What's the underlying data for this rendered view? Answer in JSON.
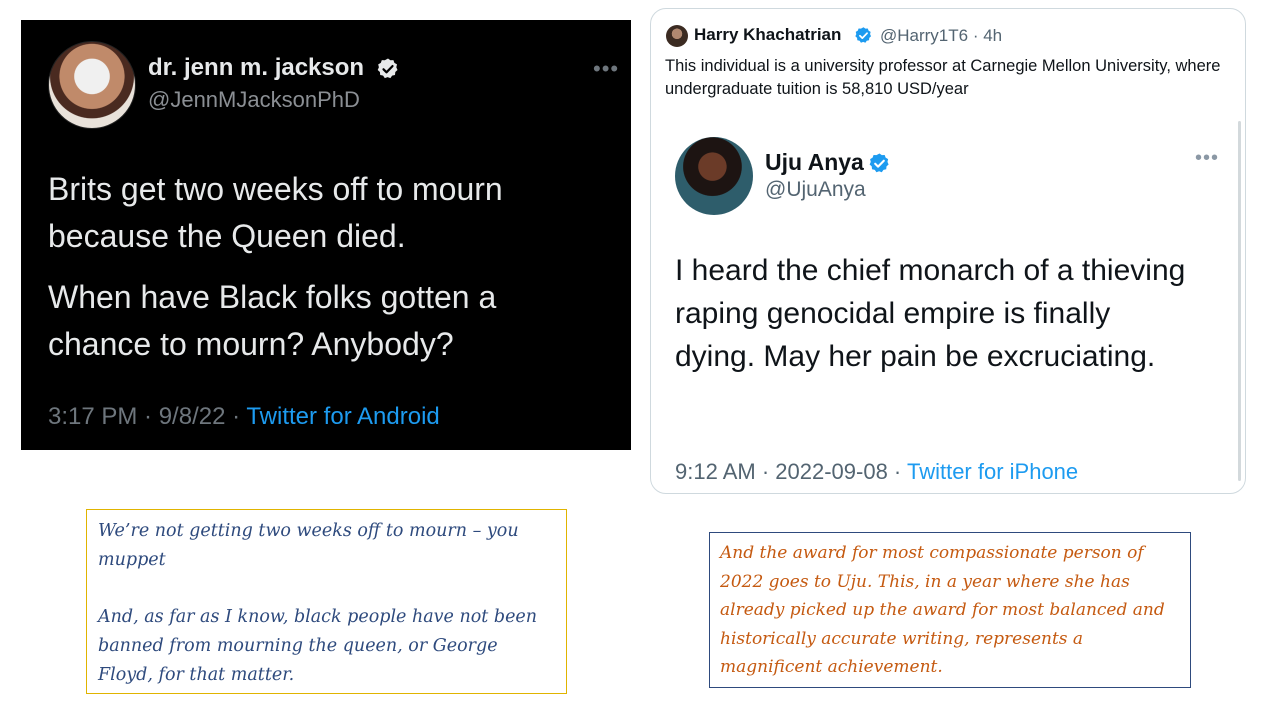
{
  "dark_tweet": {
    "display_name": "dr. jenn m. jackson",
    "handle": "@JennMJacksonPhD",
    "paragraph_1": "Brits get two weeks off to mourn because the Queen died.",
    "paragraph_2": "When have Black folks gotten a chance to mourn? Anybody?",
    "timestamp": "3:17 PM · 9/8/22 · ",
    "source": "Twitter for Android",
    "more_label": "•••",
    "icons": {
      "verified": "verified-badge-icon",
      "more": "more-options-icon"
    }
  },
  "quote_tweet": {
    "display_name": "Harry Khachatrian",
    "handle": "@Harry1T6 · 4h",
    "text": "This individual is a university professor at Carnegie Mellon University, where undergraduate tuition is 58,810 USD/year",
    "quoted": {
      "display_name": "Uju Anya",
      "handle": "@UjuAnya",
      "body": "I heard the chief monarch of a thieving raping genocidal empire is finally dying. May her pain be excruciating.",
      "timestamp": "9:12 AM · 2022-09-08 · ",
      "source": "Twitter for iPhone",
      "more_label": "•••"
    }
  },
  "comments": {
    "left_p1": "We’re not getting two weeks off to mourn – you muppet",
    "left_p2": "And, as far as I know, black people have not been banned from mourning the queen, or George Floyd, for that matter.",
    "right": "And the award for most compassionate person of 2022 goes to Uju. This, in a year where she has already picked up the award for most balanced and historically accurate writing, represents a magnificent achievement."
  },
  "colors": {
    "twitter_blue": "#1d9bf0",
    "dark_bg": "#000000",
    "left_comment_text": "#2e4a7d",
    "left_comment_border": "#e0b400",
    "right_comment_text": "#c55a11",
    "right_comment_border": "#2e4a7d"
  }
}
